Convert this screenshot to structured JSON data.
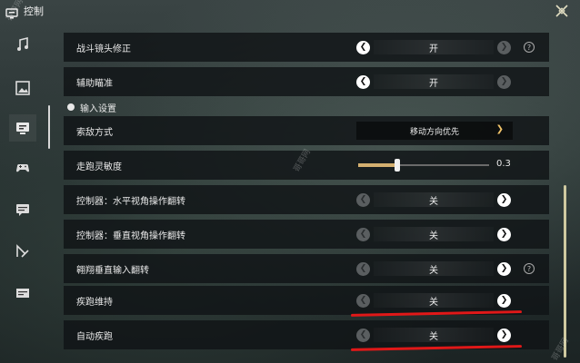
{
  "header": {
    "title": "控制"
  },
  "sidebar": {
    "items": [
      {
        "icon": "music-note-icon"
      },
      {
        "icon": "picture-icon"
      },
      {
        "icon": "monitor-icon",
        "active": true
      },
      {
        "icon": "gamepad-icon"
      },
      {
        "icon": "chat-icon"
      },
      {
        "icon": "cursor-pencil-icon"
      },
      {
        "icon": "keyboard-icon"
      }
    ]
  },
  "rows": {
    "r1": {
      "label": "战斗镜头修正",
      "value": "开"
    },
    "r2": {
      "label": "辅助瞄准",
      "value": "开"
    },
    "section": {
      "label": "输入设置"
    },
    "r3": {
      "label": "索敌方式",
      "value": "移动方向优先"
    },
    "r4": {
      "label": "走跑灵敏度",
      "value": "0.3",
      "fraction": 0.3
    },
    "r5": {
      "label": "控制器：水平视角操作翻转",
      "value": "关"
    },
    "r6": {
      "label": "控制器：垂直视角操作翻转",
      "value": "关"
    },
    "r7": {
      "label": "翱翔垂直输入翻转",
      "value": "关"
    },
    "r8": {
      "label": "疾跑维持",
      "value": "关"
    },
    "r9": {
      "label": "自动疾跑",
      "value": "关"
    }
  },
  "help_symbol": "?",
  "watermark": "哥哥网",
  "colors": {
    "accent": "#d4b070",
    "highlight": "#e01818",
    "dropdown_chevron": "#f2c46a"
  }
}
